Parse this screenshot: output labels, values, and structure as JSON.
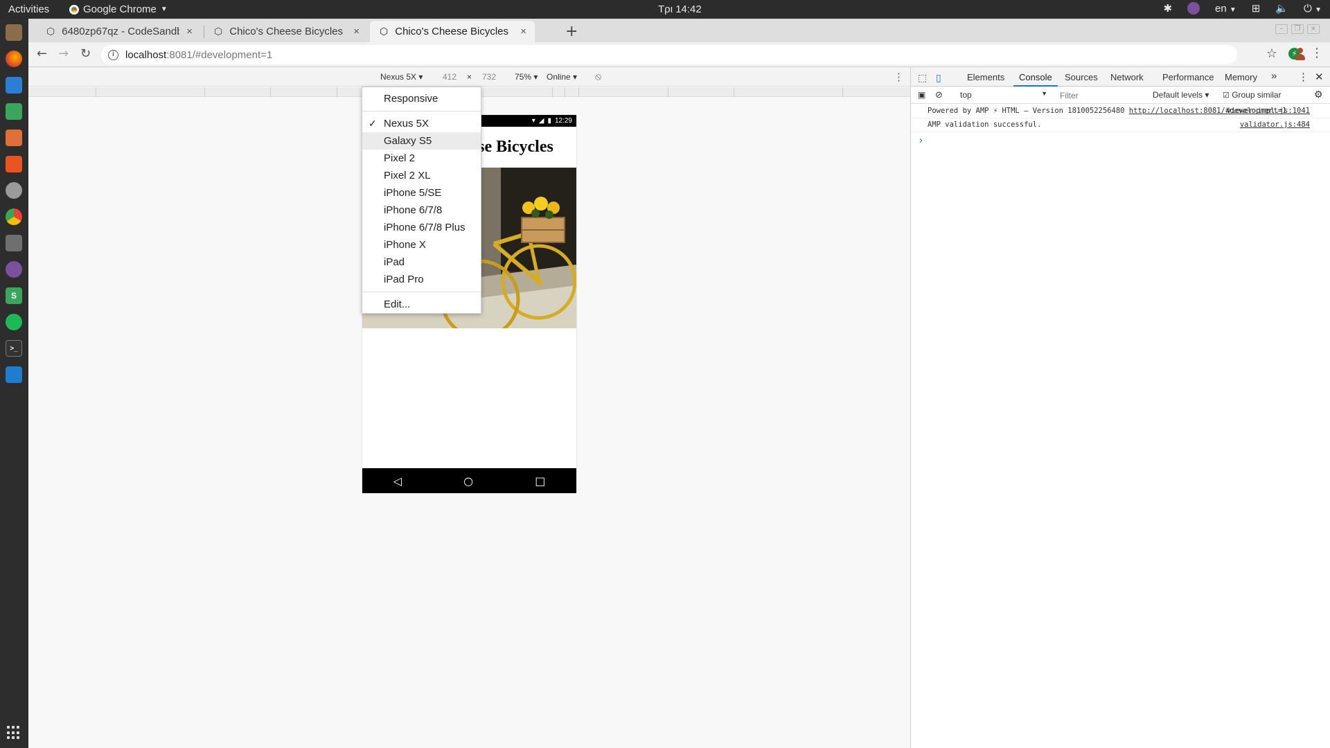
{
  "os": {
    "activities": "Activities",
    "app_name": "Google Chrome",
    "clock": "Τρι 14:42",
    "lang": "en"
  },
  "dock": {
    "apps": [
      {
        "name": "files",
        "label": ""
      },
      {
        "name": "firefox",
        "label": ""
      },
      {
        "name": "writer",
        "label": ""
      },
      {
        "name": "calc",
        "label": ""
      },
      {
        "name": "impress",
        "label": ""
      },
      {
        "name": "software",
        "label": ""
      },
      {
        "name": "settings",
        "label": ""
      },
      {
        "name": "chrome",
        "label": ""
      },
      {
        "name": "screenshot",
        "label": ""
      },
      {
        "name": "viber",
        "label": ""
      },
      {
        "name": "slack",
        "label": "S"
      },
      {
        "name": "spotify",
        "label": ""
      },
      {
        "name": "terminal",
        "label": ""
      },
      {
        "name": "vscode",
        "label": ""
      }
    ]
  },
  "browser": {
    "tabs": [
      {
        "title": "6480zp67qz - CodeSandbox",
        "close": "×"
      },
      {
        "title": "Chico's Cheese Bicycles",
        "close": "×"
      },
      {
        "title": "Chico's Cheese Bicycles",
        "close": "×"
      }
    ],
    "new_tab": "+",
    "url_host": "localhost",
    "url_rest": ":8081/#development=1",
    "info_icon": "i"
  },
  "device_toolbar": {
    "device": "Nexus 5X ▾",
    "width": "412",
    "times": "×",
    "height": "732",
    "zoom": "75% ▾",
    "network": "Online ▾"
  },
  "device_menu": {
    "responsive": "Responsive",
    "devices": [
      {
        "label": "Nexus 5X",
        "checked": true
      },
      {
        "label": "Galaxy S5",
        "hover": true
      },
      {
        "label": "Pixel 2"
      },
      {
        "label": "Pixel 2 XL"
      },
      {
        "label": "iPhone 5/SE"
      },
      {
        "label": "iPhone 6/7/8"
      },
      {
        "label": "iPhone 6/7/8 Plus"
      },
      {
        "label": "iPhone X"
      },
      {
        "label": "iPad"
      },
      {
        "label": "iPad Pro"
      }
    ],
    "edit": "Edit...",
    "check": "✓"
  },
  "phone": {
    "status_time": "12:29",
    "heading": "Chico's Cheese Bicycles",
    "nav_back": "◁",
    "nav_home": "○",
    "nav_recent": "□"
  },
  "devtools": {
    "tabs": [
      "Elements",
      "Console",
      "Sources",
      "Network",
      "Performance",
      "Memory"
    ],
    "more": "»",
    "context": "top",
    "filter_placeholder": "Filter",
    "levels": "Default levels ▾",
    "group_similar": "Group similar",
    "logs": [
      {
        "text": "Powered by AMP ⚡ HTML – Version 1810052256480 ",
        "link": "http://localhost:8081/#development=1",
        "source": "viewer-impl.js:1041"
      },
      {
        "text": "AMP validation successful.",
        "link": "",
        "source": "validator.js:484"
      }
    ],
    "prompt": "›"
  },
  "colors": {
    "accent": "#1a73e8",
    "topbar": "#2c2c2c",
    "dock": "#2d2d2d"
  }
}
